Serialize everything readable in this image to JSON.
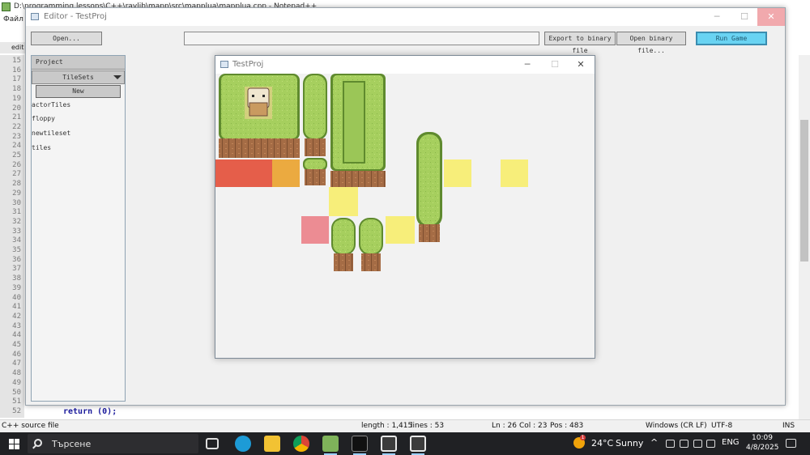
{
  "notepad": {
    "title": "D:\\programming lessons\\C++\\raylib\\mapp\\src\\mapplua\\mapplua.cpp - Notepad++",
    "menu_first": "Файл",
    "tab_label": "edit",
    "line_numbers": [
      "15",
      "16",
      "17",
      "18",
      "19",
      "20",
      "21",
      "22",
      "23",
      "24",
      "25",
      "26",
      "27",
      "28",
      "29",
      "30",
      "31",
      "32",
      "33",
      "34",
      "35",
      "36",
      "37",
      "38",
      "39",
      "40",
      "41",
      "42",
      "43",
      "44",
      "45",
      "46",
      "47",
      "48",
      "49",
      "50",
      "51",
      "52"
    ],
    "code_line": "return (0);",
    "status": {
      "file_type": "C++ source file",
      "length": "length : 1,415",
      "lines": "lines : 53",
      "ln": "Ln : 26",
      "col": "Col : 23",
      "pos": "Pos : 483",
      "eol": "Windows (CR LF)",
      "encoding": "UTF-8",
      "mode": "INS"
    }
  },
  "editor": {
    "title": "Editor - TestProj",
    "open_label": "Open...",
    "path_value": "",
    "export_label": "Export to binary file",
    "open_binary_label": "Open binary file...",
    "run_label": "Run Game",
    "panel": {
      "project_label": "Project",
      "tilesets_label": "TileSets",
      "new_label": "New",
      "tilesets": [
        "actorTiles",
        "floppy",
        "newtileset",
        "tiles"
      ]
    }
  },
  "game_window": {
    "title": "TestProj"
  },
  "taskbar": {
    "search_placeholder": "Търсене",
    "weather_temp": "24°C",
    "weather_desc": "Sunny",
    "weather_badge": "1",
    "language": "ENG",
    "time": "10:09",
    "date": "4/8/2025"
  },
  "colors": {
    "grass": "#9ec95a",
    "grass_dark": "#6f9a3a",
    "dirt": "#a56c45",
    "highlight_yellow": "#f7ee7a",
    "highlight_red": "#ec8c93",
    "run_button": "#69d3f2"
  },
  "icons": [
    "start-icon",
    "search-icon",
    "task-view-icon",
    "edge-icon",
    "explorer-icon",
    "chrome-icon",
    "notepadpp-icon",
    "terminal-icon",
    "editor-app-icon",
    "raylib-app-icon",
    "weather-icon",
    "chevron-up-icon",
    "network-icon",
    "volume-icon",
    "notification-icon"
  ]
}
